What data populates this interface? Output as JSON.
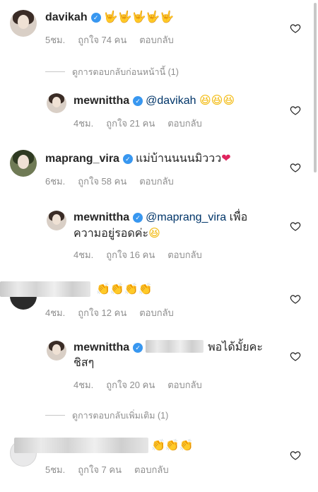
{
  "comments": [
    {
      "username": "davikah",
      "text": "🤟🤟🤟🤟🤟",
      "time": "5ชม.",
      "likes": "ถูกใจ 74 คน",
      "reply": "ตอบกลับ"
    },
    {
      "view_replies": "ดูการตอบกลับก่อนหน้านี้ (1)"
    },
    {
      "username": "mewnittha",
      "mention": "@davikah",
      "text": "😆😆😆",
      "time": "4ชม.",
      "likes": "ถูกใจ 21 คน",
      "reply": "ตอบกลับ"
    },
    {
      "username": "maprang_vira",
      "text": "แม่บ้านนนนมิววว",
      "emoji": "❤",
      "time": "6ชม.",
      "likes": "ถูกใจ 58 คน",
      "reply": "ตอบกลับ"
    },
    {
      "username": "mewnittha",
      "mention": "@maprang_vira",
      "text_line1": "เพื่อ",
      "text_line2": "ความอยู่รอดค่ะ",
      "emoji": "😆",
      "time": "4ชม.",
      "likes": "ถูกใจ 16 คน",
      "reply": "ตอบกลับ"
    },
    {
      "text": "👏👏👏👏",
      "time": "4ชม.",
      "likes": "ถูกใจ 12 คน",
      "reply": "ตอบกลับ"
    },
    {
      "username": "mewnittha",
      "text_line1": "พอได้มั้ยคะ",
      "text_line2": "ชิสๆ",
      "time": "4ชม.",
      "likes": "ถูกใจ 20 คน",
      "reply": "ตอบกลับ"
    },
    {
      "view_replies": "ดูการตอบกลับเพิ่มเติม (1)"
    },
    {
      "text": "👏👏👏",
      "time": "5ชม.",
      "likes": "ถูกใจ 7 คน",
      "reply": "ตอบกลับ"
    }
  ],
  "verified_mark": "✓",
  "colors": {
    "verified": "#3897f0",
    "mention": "#003569",
    "meta": "#8e8e8e",
    "heart_red": "#e0245e"
  },
  "icons": {
    "like": "heart-outline-icon",
    "verified": "verified-badge-icon"
  }
}
